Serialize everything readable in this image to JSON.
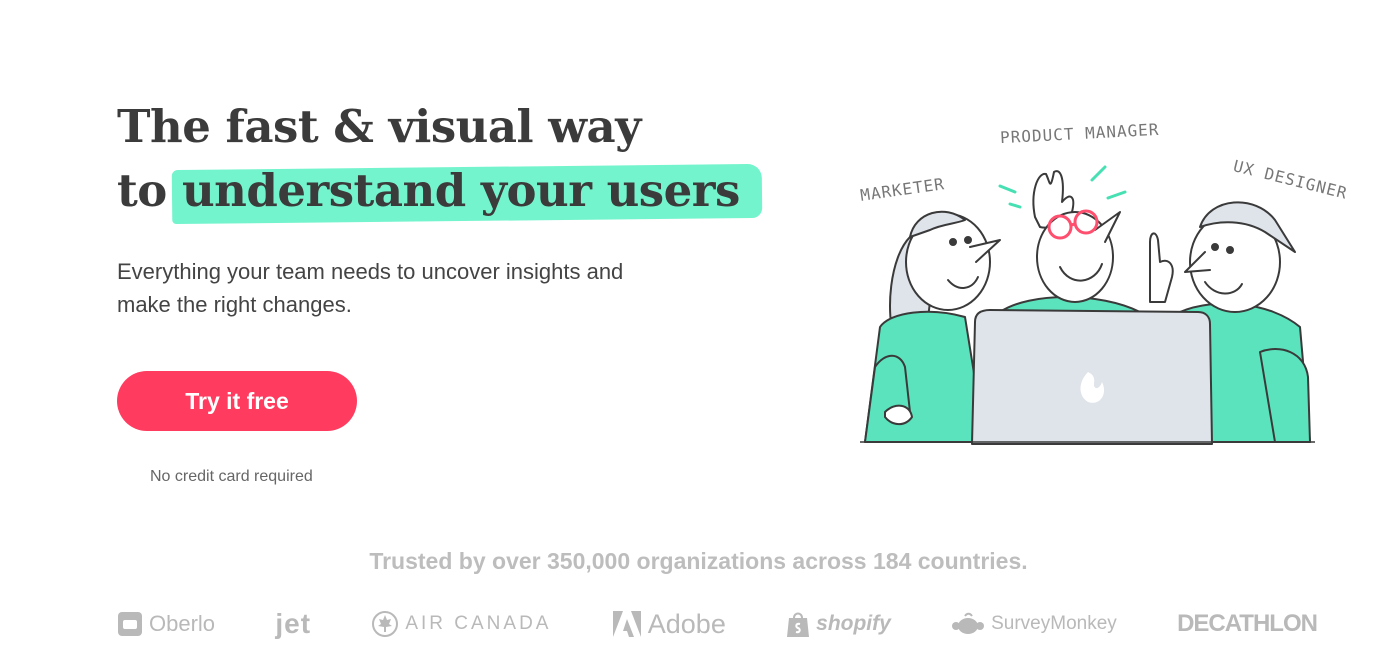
{
  "hero": {
    "headline_line1": "The fast & visual way",
    "headline_prefix": "to ",
    "headline_highlight": "understand your users",
    "subtitle": "Everything your team needs to uncover insights and make the right changes.",
    "cta_label": "Try it free",
    "cta_note": "No credit card required"
  },
  "illustration": {
    "labels": {
      "marketer": "MARKETER",
      "product_manager": "PRODUCT MANAGER",
      "ux_designer": "UX DESIGNER"
    }
  },
  "trust": {
    "text": "Trusted by over 350,000 organizations across 184 countries.",
    "logos": [
      {
        "name": "Oberlo",
        "icon": "oberlo-icon"
      },
      {
        "name": "jet",
        "icon": "jet-wordmark"
      },
      {
        "name": "AIR CANADA",
        "icon": "maple-leaf-icon"
      },
      {
        "name": "Adobe",
        "icon": "adobe-icon"
      },
      {
        "name": "shopify",
        "icon": "shopify-bag-icon"
      },
      {
        "name": "SurveyMonkey",
        "icon": "surveymonkey-icon"
      },
      {
        "name": "DECATHLON",
        "icon": "decathlon-wordmark"
      }
    ]
  },
  "colors": {
    "accent_highlight": "#5cf2c4",
    "cta": "#ff3c5f",
    "shirt": "#5be3bd",
    "laptop": "#dfe3ea",
    "logo_gray": "#b9b9b9"
  }
}
